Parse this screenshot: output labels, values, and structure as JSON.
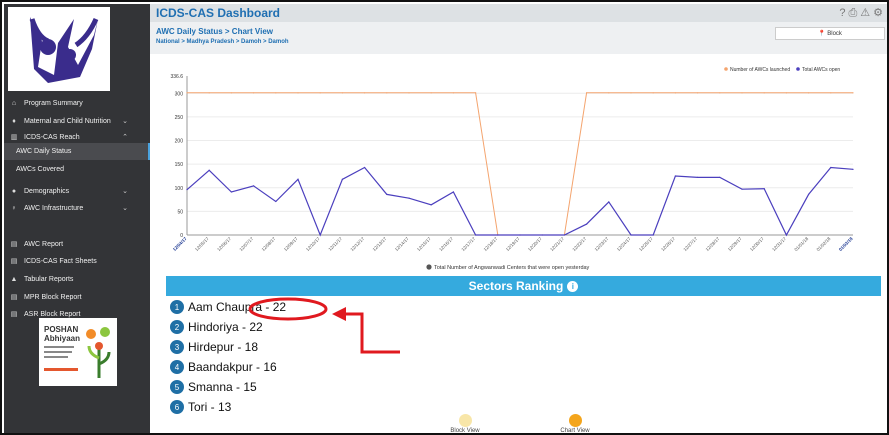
{
  "app": {
    "title": "ICDS-CAS Dashboard"
  },
  "header": {
    "icons": [
      "help-icon",
      "print-icon",
      "alert-icon",
      "gear-icon"
    ]
  },
  "page": {
    "heading": "AWC Daily Status > Chart View",
    "breadcrumb": "National > Madhya Pradesh > Damoh > Damoh",
    "block_button": "📍 Block"
  },
  "sidebar": {
    "items": [
      {
        "label": "Program Summary",
        "icon": "home-icon"
      },
      {
        "label": "Maternal and Child Nutrition",
        "icon": "child-icon"
      },
      {
        "label": "ICDS-CAS Reach",
        "icon": "bar-chart-icon"
      },
      {
        "label": "AWC Daily Status",
        "icon": ""
      },
      {
        "label": "AWCs Covered",
        "icon": ""
      },
      {
        "label": "Demographics",
        "icon": "users-icon"
      },
      {
        "label": "AWC Infrastructure",
        "icon": "pin-icon"
      },
      {
        "label": "AWC Report",
        "icon": "report-icon"
      },
      {
        "label": "ICDS-CAS Fact Sheets",
        "icon": "report-icon"
      },
      {
        "label": "Tabular Reports",
        "icon": "table-icon"
      },
      {
        "label": "MPR Block Report",
        "icon": "report-icon"
      },
      {
        "label": "ASR Block Report",
        "icon": "report-icon"
      }
    ]
  },
  "poshan": {
    "line1": "POSHAN",
    "line2": "Abhiyaan"
  },
  "chart_data": {
    "type": "line",
    "x": [
      "12/04/17",
      "12/05/17",
      "12/06/17",
      "12/07/17",
      "12/08/17",
      "12/09/17",
      "12/10/17",
      "12/11/17",
      "12/12/17",
      "12/13/17",
      "12/14/17",
      "12/15/17",
      "12/16/17",
      "12/17/17",
      "12/18/17",
      "12/19/17",
      "12/20/17",
      "12/21/17",
      "12/22/17",
      "12/23/17",
      "12/24/17",
      "12/25/17",
      "12/26/17",
      "12/27/17",
      "12/28/17",
      "12/29/17",
      "12/30/17",
      "12/31/17",
      "01/01/18",
      "01/02/18",
      "01/03/18"
    ],
    "series": [
      {
        "name": "Number of AWCs launched",
        "color": "#f4a46e",
        "values": [
          301,
          301,
          301,
          301,
          301,
          301,
          301,
          301,
          301,
          301,
          301,
          301,
          301,
          301,
          0,
          0,
          0,
          0,
          301,
          301,
          301,
          301,
          301,
          301,
          301,
          301,
          301,
          301,
          301,
          301,
          301
        ]
      },
      {
        "name": "Total AWCs open",
        "color": "#4b3fbe",
        "values": [
          96,
          137,
          91,
          104,
          71,
          118,
          0,
          118,
          143,
          86,
          78,
          64,
          91,
          0,
          0,
          0,
          0,
          0,
          23,
          70,
          0,
          0,
          125,
          122,
          122,
          97,
          98,
          0,
          86,
          143,
          139
        ]
      }
    ],
    "ylim": [
      0,
      336.6
    ],
    "yticks": [
      0,
      50,
      100,
      150,
      200,
      250,
      300
    ],
    "ymax_label": "336.6",
    "legend": "top-right",
    "note": "Total Number of Angwanwadi Centers that were open yesterday",
    "note_icon": "info-icon"
  },
  "ranking": {
    "title": "Sectors Ranking",
    "items": [
      {
        "n": "1",
        "label": "Aam Chaupra - 22"
      },
      {
        "n": "2",
        "label": "Hindoriya - 22"
      },
      {
        "n": "3",
        "label": "Hirdepur - 18"
      },
      {
        "n": "4",
        "label": "Baandakpur - 16"
      },
      {
        "n": "5",
        "label": "Smanna - 15"
      },
      {
        "n": "6",
        "label": "Tori - 13"
      }
    ]
  },
  "views": {
    "block": {
      "label": "Block View",
      "color": "#f8e6a8"
    },
    "chart": {
      "label": "Chart View",
      "color": "#f4a51c"
    }
  },
  "annotation": {
    "color": "#e0191f"
  }
}
